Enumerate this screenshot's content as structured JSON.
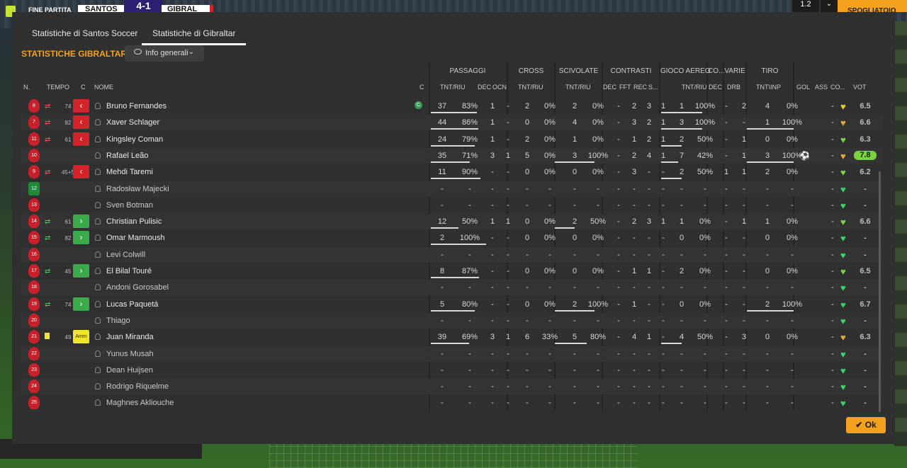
{
  "topbar": {
    "end_label": "FINE PARTITA",
    "home_team": "SANTOS",
    "score": "4-1",
    "away_team": "GIBRAL",
    "speed": "1.2",
    "dressing_room": "SPOGLIATOIO"
  },
  "tabs": [
    {
      "label": "Statistiche di Santos Soccer",
      "active": false
    },
    {
      "label": "Statistiche di Gibraltar",
      "active": true
    }
  ],
  "title": "STATISTICHE GIBRALTAR",
  "dropdown": {
    "label": "Info generali"
  },
  "groups": [
    "PASSAGGI",
    "CROSS",
    "SCIVOLATE",
    "CONTRASTI",
    "GIOCO AEREO",
    "CO...",
    "VARIE",
    "TIRO"
  ],
  "columns": {
    "num": "N.",
    "time": "TEMPO",
    "c": "C",
    "name": "NOME",
    "c2": "C",
    "pass_tnt": "TNT/RIU",
    "pass_dec": "DEC",
    "pass_ocn": "OCN",
    "cross_tnt": "TNT/RIU",
    "tack_tnt": "TNT/RIU",
    "con_dec": "DEC",
    "con_fft": "FFT",
    "con_rec": "REC",
    "con_s": "S...",
    "air_tnt": "TNT/RIU",
    "co_dec": "DEC",
    "var_drb": "DRB",
    "shot_tnt": "TNT\\INP",
    "gol": "GOL",
    "ass": "ASS",
    "co": "CO...",
    "vot": "VOT"
  },
  "players": [
    {
      "num": "8",
      "sub": "out",
      "minute": "74",
      "name": "Bruno Fernandes",
      "captain": "C",
      "pass": [
        "37",
        "83%"
      ],
      "pdec": "1",
      "pocn": "-",
      "cross": [
        "2",
        "0%"
      ],
      "tack": [
        "2",
        "0%"
      ],
      "con": [
        "-",
        "2",
        "3",
        "1"
      ],
      "air": [
        "1",
        "100%"
      ],
      "codec": "-",
      "drb": "2",
      "shot": [
        "4",
        "0%"
      ],
      "gol": "",
      "ass": "-",
      "heart": "yellow",
      "vot": "6.5"
    },
    {
      "num": "7",
      "sub": "out",
      "minute": "82",
      "name": "Xaver Schlager",
      "pass": [
        "44",
        "86%"
      ],
      "pdec": "1",
      "pocn": "-",
      "cross": [
        "0",
        "0%"
      ],
      "tack": [
        "4",
        "0%"
      ],
      "con": [
        "-",
        "3",
        "2",
        "1"
      ],
      "air": [
        "3",
        "100%"
      ],
      "codec": "-",
      "drb": "-",
      "shot": [
        "1",
        "100%"
      ],
      "gol": "",
      "ass": "-",
      "heart": "orange",
      "vot": "6.6"
    },
    {
      "num": "11",
      "sub": "out",
      "minute": "61",
      "name": "Kingsley Coman",
      "pass": [
        "24",
        "79%"
      ],
      "pdec": "1",
      "pocn": "-",
      "cross": [
        "2",
        "0%"
      ],
      "tack": [
        "1",
        "0%"
      ],
      "con": [
        "-",
        "1",
        "2",
        "1"
      ],
      "air": [
        "2",
        "50%"
      ],
      "codec": "-",
      "drb": "1",
      "shot": [
        "0",
        "0%"
      ],
      "gol": "",
      "ass": "-",
      "heart": "lightgreen",
      "vot": "6.3"
    },
    {
      "num": "10",
      "sub": "",
      "minute": "",
      "name": "Rafael Leão",
      "pass": [
        "35",
        "71%"
      ],
      "pdec": "3",
      "pocn": "1",
      "cross": [
        "5",
        "0%"
      ],
      "tack": [
        "3",
        "100%"
      ],
      "con": [
        "-",
        "2",
        "4",
        "1"
      ],
      "air": [
        "7",
        "42%"
      ],
      "codec": "-",
      "drb": "1",
      "shot": [
        "3",
        "100%"
      ],
      "gol": "ball",
      "ass": "-",
      "heart": "orange",
      "vot": "7.8",
      "best": true
    },
    {
      "num": "9",
      "sub": "out",
      "minute": "45+5",
      "name": "Mehdi Taremi",
      "pass": [
        "11",
        "90%"
      ],
      "pdec": "-",
      "pocn": "-",
      "cross": [
        "0",
        "0%"
      ],
      "tack": [
        "0",
        "0%"
      ],
      "con": [
        "-",
        "3",
        "-",
        "-"
      ],
      "air": [
        "2",
        "50%"
      ],
      "codec": "1",
      "drb": "1",
      "shot": [
        "2",
        "0%"
      ],
      "gol": "",
      "ass": "-",
      "heart": "lightgreen",
      "vot": "6.2"
    },
    {
      "num": "12",
      "gk": true,
      "sub": "",
      "minute": "",
      "name": "Radosław Majecki",
      "pass": [
        "-",
        "-"
      ],
      "pdec": "-",
      "pocn": "-",
      "cross": [
        "-",
        "-"
      ],
      "tack": [
        "-",
        "-"
      ],
      "con": [
        "-",
        "-",
        "-",
        "-"
      ],
      "air": [
        "-",
        "-"
      ],
      "codec": "-",
      "drb": "-",
      "shot": [
        "-",
        "-"
      ],
      "gol": "",
      "ass": "-",
      "heart": "green",
      "vot": "-"
    },
    {
      "num": "13",
      "sub": "",
      "minute": "",
      "name": "Sven Botman",
      "pass": [
        "-",
        "-"
      ],
      "pdec": "-",
      "pocn": "-",
      "cross": [
        "-",
        "-"
      ],
      "tack": [
        "-",
        "-"
      ],
      "con": [
        "-",
        "-",
        "-",
        "-"
      ],
      "air": [
        "-",
        "-"
      ],
      "codec": "-",
      "drb": "-",
      "shot": [
        "-",
        "-"
      ],
      "gol": "",
      "ass": "-",
      "heart": "green",
      "vot": "-"
    },
    {
      "num": "14",
      "sub": "in",
      "minute": "61",
      "name": "Christian Pulisic",
      "pass": [
        "12",
        "50%"
      ],
      "pdec": "1",
      "pocn": "1",
      "cross": [
        "0",
        "0%"
      ],
      "tack": [
        "2",
        "50%"
      ],
      "con": [
        "-",
        "2",
        "3",
        "1"
      ],
      "air": [
        "1",
        "0%"
      ],
      "codec": "-",
      "drb": "1",
      "shot": [
        "1",
        "0%"
      ],
      "gol": "",
      "ass": "-",
      "heart": "lightgreen",
      "vot": "6.6"
    },
    {
      "num": "15",
      "sub": "in",
      "minute": "82",
      "name": "Omar Marmoush",
      "pass": [
        "2",
        "100%"
      ],
      "pdec": "-",
      "pocn": "-",
      "cross": [
        "0",
        "0%"
      ],
      "tack": [
        "0",
        "0%"
      ],
      "con": [
        "-",
        "-",
        "-",
        "-"
      ],
      "air": [
        "0",
        "0%"
      ],
      "codec": "-",
      "drb": "-",
      "shot": [
        "0",
        "0%"
      ],
      "gol": "",
      "ass": "-",
      "heart": "green",
      "vot": "-"
    },
    {
      "num": "16",
      "sub": "",
      "minute": "",
      "name": "Levi Colwill",
      "pass": [
        "-",
        "-"
      ],
      "pdec": "-",
      "pocn": "-",
      "cross": [
        "-",
        "-"
      ],
      "tack": [
        "-",
        "-"
      ],
      "con": [
        "-",
        "-",
        "-",
        "-"
      ],
      "air": [
        "-",
        "-"
      ],
      "codec": "-",
      "drb": "-",
      "shot": [
        "-",
        "-"
      ],
      "gol": "",
      "ass": "-",
      "heart": "green",
      "vot": "-"
    },
    {
      "num": "17",
      "sub": "in",
      "minute": "45",
      "name": "El Bilal Touré",
      "pass": [
        "8",
        "87%"
      ],
      "pdec": "-",
      "pocn": "-",
      "cross": [
        "0",
        "0%"
      ],
      "tack": [
        "0",
        "0%"
      ],
      "con": [
        "-",
        "1",
        "1",
        "-"
      ],
      "air": [
        "2",
        "0%"
      ],
      "codec": "-",
      "drb": "-",
      "shot": [
        "0",
        "0%"
      ],
      "gol": "",
      "ass": "-",
      "heart": "lightgreen",
      "vot": "6.5"
    },
    {
      "num": "18",
      "sub": "",
      "minute": "",
      "name": "Andoni Gorosabel",
      "pass": [
        "-",
        "-"
      ],
      "pdec": "-",
      "pocn": "-",
      "cross": [
        "-",
        "-"
      ],
      "tack": [
        "-",
        "-"
      ],
      "con": [
        "-",
        "-",
        "-",
        "-"
      ],
      "air": [
        "-",
        "-"
      ],
      "codec": "-",
      "drb": "-",
      "shot": [
        "-",
        "-"
      ],
      "gol": "",
      "ass": "-",
      "heart": "green",
      "vot": "-"
    },
    {
      "num": "19",
      "sub": "in",
      "minute": "74",
      "name": "Lucas Paquetá",
      "pass": [
        "5",
        "80%"
      ],
      "pdec": "-",
      "pocn": "-",
      "cross": [
        "0",
        "0%"
      ],
      "tack": [
        "2",
        "100%"
      ],
      "con": [
        "-",
        "1",
        "-",
        "-"
      ],
      "air": [
        "0",
        "0%"
      ],
      "codec": "-",
      "drb": "-",
      "shot": [
        "2",
        "100%"
      ],
      "gol": "",
      "ass": "-",
      "heart": "green",
      "vot": "6.7"
    },
    {
      "num": "20",
      "sub": "",
      "minute": "",
      "name": "Thiago",
      "pass": [
        "-",
        "-"
      ],
      "pdec": "-",
      "pocn": "-",
      "cross": [
        "-",
        "-"
      ],
      "tack": [
        "-",
        "-"
      ],
      "con": [
        "-",
        "-",
        "-",
        "-"
      ],
      "air": [
        "-",
        "-"
      ],
      "codec": "-",
      "drb": "-",
      "shot": [
        "-",
        "-"
      ],
      "gol": "",
      "ass": "-",
      "heart": "green",
      "vot": "-"
    },
    {
      "num": "21",
      "sub": "card",
      "minute": "49",
      "amm": "Amm",
      "name": "Juan Miranda",
      "pass": [
        "39",
        "69%"
      ],
      "pdec": "3",
      "pocn": "1",
      "cross": [
        "6",
        "33%"
      ],
      "tack": [
        "5",
        "80%"
      ],
      "con": [
        "-",
        "4",
        "1",
        "-"
      ],
      "air": [
        "4",
        "50%"
      ],
      "codec": "-",
      "drb": "3",
      "shot": [
        "0",
        "0%"
      ],
      "gol": "",
      "ass": "-",
      "heart": "orange",
      "vot": "6.3"
    },
    {
      "num": "22",
      "sub": "",
      "minute": "",
      "name": "Yunus Musah",
      "pass": [
        "-",
        "-"
      ],
      "pdec": "-",
      "pocn": "-",
      "cross": [
        "-",
        "-"
      ],
      "tack": [
        "-",
        "-"
      ],
      "con": [
        "-",
        "-",
        "-",
        "-"
      ],
      "air": [
        "-",
        "-"
      ],
      "codec": "-",
      "drb": "-",
      "shot": [
        "-",
        "-"
      ],
      "gol": "",
      "ass": "-",
      "heart": "green",
      "vot": "-"
    },
    {
      "num": "23",
      "sub": "",
      "minute": "",
      "name": "Dean Huijsen",
      "pass": [
        "-",
        "-"
      ],
      "pdec": "-",
      "pocn": "-",
      "cross": [
        "-",
        "-"
      ],
      "tack": [
        "-",
        "-"
      ],
      "con": [
        "-",
        "-",
        "-",
        "-"
      ],
      "air": [
        "-",
        "-"
      ],
      "codec": "-",
      "drb": "-",
      "shot": [
        "-",
        "-"
      ],
      "gol": "",
      "ass": "-",
      "heart": "green",
      "vot": "-"
    },
    {
      "num": "24",
      "sub": "",
      "minute": "",
      "name": "Rodrigo Riquelme",
      "pass": [
        "-",
        "-"
      ],
      "pdec": "-",
      "pocn": "-",
      "cross": [
        "-",
        "-"
      ],
      "tack": [
        "-",
        "-"
      ],
      "con": [
        "-",
        "-",
        "-",
        "-"
      ],
      "air": [
        "-",
        "-"
      ],
      "codec": "-",
      "drb": "-",
      "shot": [
        "-",
        "-"
      ],
      "gol": "",
      "ass": "-",
      "heart": "green",
      "vot": "-"
    },
    {
      "num": "25",
      "sub": "",
      "minute": "",
      "name": "Maghnes Akliouche",
      "pass": [
        "-",
        "-"
      ],
      "pdec": "-",
      "pocn": "-",
      "cross": [
        "-",
        "-"
      ],
      "tack": [
        "-",
        "-"
      ],
      "con": [
        "-",
        "-",
        "-",
        "-"
      ],
      "air": [
        "-",
        "-"
      ],
      "codec": "-",
      "drb": "-",
      "shot": [
        "-",
        "-"
      ],
      "gol": "",
      "ass": "-",
      "heart": "green",
      "vot": "-"
    }
  ],
  "heart_colors": {
    "yellow": "#e2d22a",
    "orange": "#e9a73a",
    "lightgreen": "#7fd34a",
    "green": "#3ad46a"
  },
  "ok_button": "Ok"
}
